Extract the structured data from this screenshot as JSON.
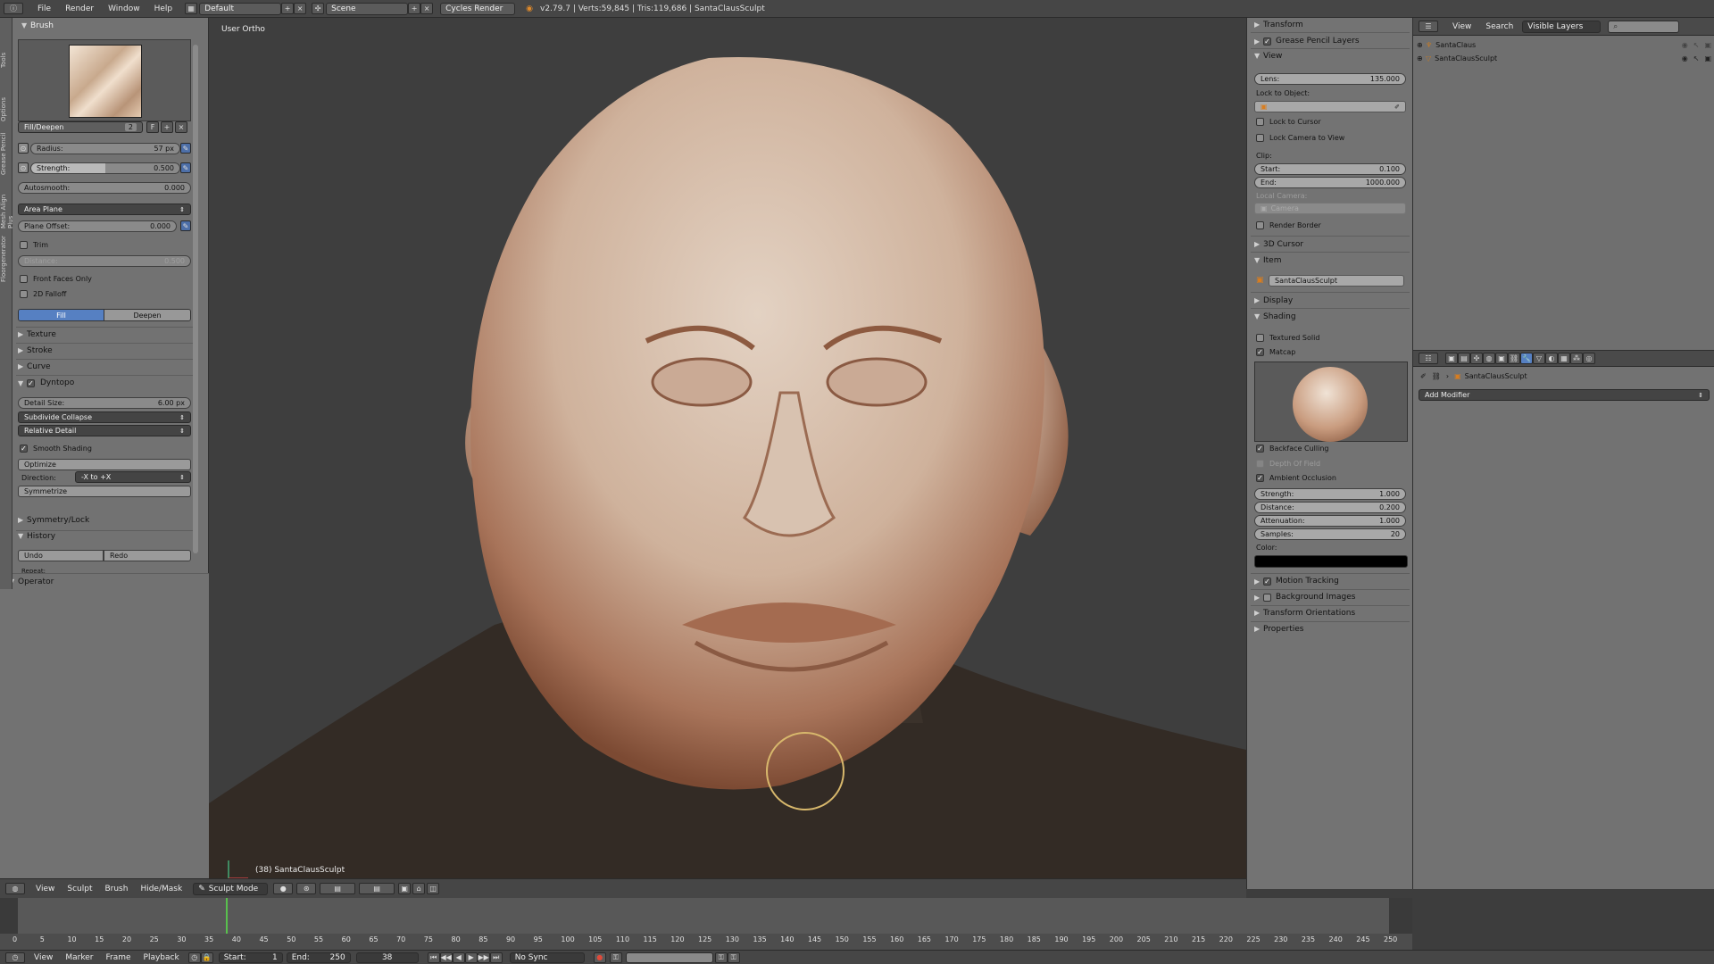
{
  "app": {
    "menus": [
      "File",
      "Render",
      "Window",
      "Help"
    ],
    "layout": "Default",
    "scene": "Scene",
    "engine": "Cycles Render",
    "stats": "v2.79.7 | Verts:59,845 | Tris:119,686 | SantaClausSculpt"
  },
  "left_tabs": [
    "Tools",
    "Options",
    "Grease Pencil",
    "Mesh Align Plus",
    "Floorgenerator"
  ],
  "brush": {
    "header": "Brush",
    "name": "Fill/Deepen",
    "users": "2",
    "fake": "F",
    "radius_label": "Radius:",
    "radius_value": "57 px",
    "strength_label": "Strength:",
    "strength_value": "0.500",
    "strength_fraction": 0.5,
    "autosmooth_label": "Autosmooth:",
    "autosmooth_value": "0.000",
    "plane": "Area Plane",
    "plane_offset_label": "Plane Offset:",
    "plane_offset_value": "0.000",
    "trim_label": "Trim",
    "distance_label": "Distance:",
    "distance_value": "0.500",
    "front_faces": "Front Faces Only",
    "falloff_2d": "2D Falloff",
    "fill_label": "Fill",
    "deepen_label": "Deepen"
  },
  "left_sections": {
    "texture": "Texture",
    "stroke": "Stroke",
    "curve": "Curve",
    "dyntopo": "Dyntopo",
    "detail_size_label": "Detail Size:",
    "detail_size_value": "6.00 px",
    "subdivide": "Subdivide Collapse",
    "relative": "Relative Detail",
    "smooth_shading": "Smooth Shading",
    "optimize": "Optimize",
    "direction_label": "Direction:",
    "direction_value": "-X to +X",
    "symmetrize": "Symmetrize",
    "symmetry_lock": "Symmetry/Lock",
    "history": "History",
    "undo": "Undo",
    "redo": "Redo",
    "repeat": "Repeat:",
    "operator": "Operator"
  },
  "viewport": {
    "mode_label": "User Ortho",
    "object_label": "(38) SantaClausSculpt"
  },
  "view_header": {
    "items": [
      "View",
      "Sculpt",
      "Brush",
      "Hide/Mask"
    ],
    "mode": "Sculpt Mode"
  },
  "right_panel": {
    "transform": "Transform",
    "grease": "Grease Pencil Layers",
    "view": "View",
    "lens_label": "Lens:",
    "lens_value": "135.000",
    "lock_object": "Lock to Object:",
    "lock_cursor": "Lock to Cursor",
    "lock_camera": "Lock Camera to View",
    "clip": "Clip:",
    "start_label": "Start:",
    "start_value": "0.100",
    "end_label": "End:",
    "end_value": "1000.000",
    "local_camera": "Local Camera:",
    "camera": "Camera",
    "render_border": "Render Border",
    "cursor": "3D Cursor",
    "item": "Item",
    "item_name": "SantaClausSculpt",
    "display": "Display",
    "shading": "Shading",
    "textured_solid": "Textured Solid",
    "matcap": "Matcap",
    "backface": "Backface Culling",
    "dof": "Depth Of Field",
    "ao": "Ambient Occlusion",
    "ao_strength_label": "Strength:",
    "ao_strength_value": "1.000",
    "ao_distance_label": "Distance:",
    "ao_distance_value": "0.200",
    "ao_atten_label": "Attenuation:",
    "ao_atten_value": "1.000",
    "ao_samples_label": "Samples:",
    "ao_samples_value": "20",
    "color_label": "Color:",
    "motion": "Motion Tracking",
    "bg_images": "Background Images",
    "orientations": "Transform Orientations",
    "properties": "Properties"
  },
  "outliner": {
    "view": "View",
    "search": "Search",
    "filter": "Visible Layers",
    "items": [
      "SantaClaus",
      "SantaClausSculpt"
    ]
  },
  "props": {
    "object": "SantaClausSculpt",
    "add_modifier": "Add Modifier"
  },
  "timeline": {
    "ticks": [
      "0",
      "5",
      "10",
      "15",
      "20",
      "25",
      "30",
      "35",
      "40",
      "45",
      "50",
      "55",
      "60",
      "65",
      "70",
      "75",
      "80",
      "85",
      "90",
      "95",
      "100",
      "105",
      "110",
      "115",
      "120",
      "125",
      "130",
      "135",
      "140",
      "145",
      "150",
      "155",
      "160",
      "165",
      "170",
      "175",
      "180",
      "185",
      "190",
      "195",
      "200",
      "205",
      "210",
      "215",
      "220",
      "225",
      "230",
      "235",
      "240",
      "245",
      "250"
    ],
    "current_frame_value": 38,
    "menu": [
      "View",
      "Marker",
      "Frame",
      "Playback"
    ],
    "start_label": "Start:",
    "start_value": "1",
    "end_label": "End:",
    "end_value": "250",
    "current": "38",
    "sync": "No Sync"
  }
}
